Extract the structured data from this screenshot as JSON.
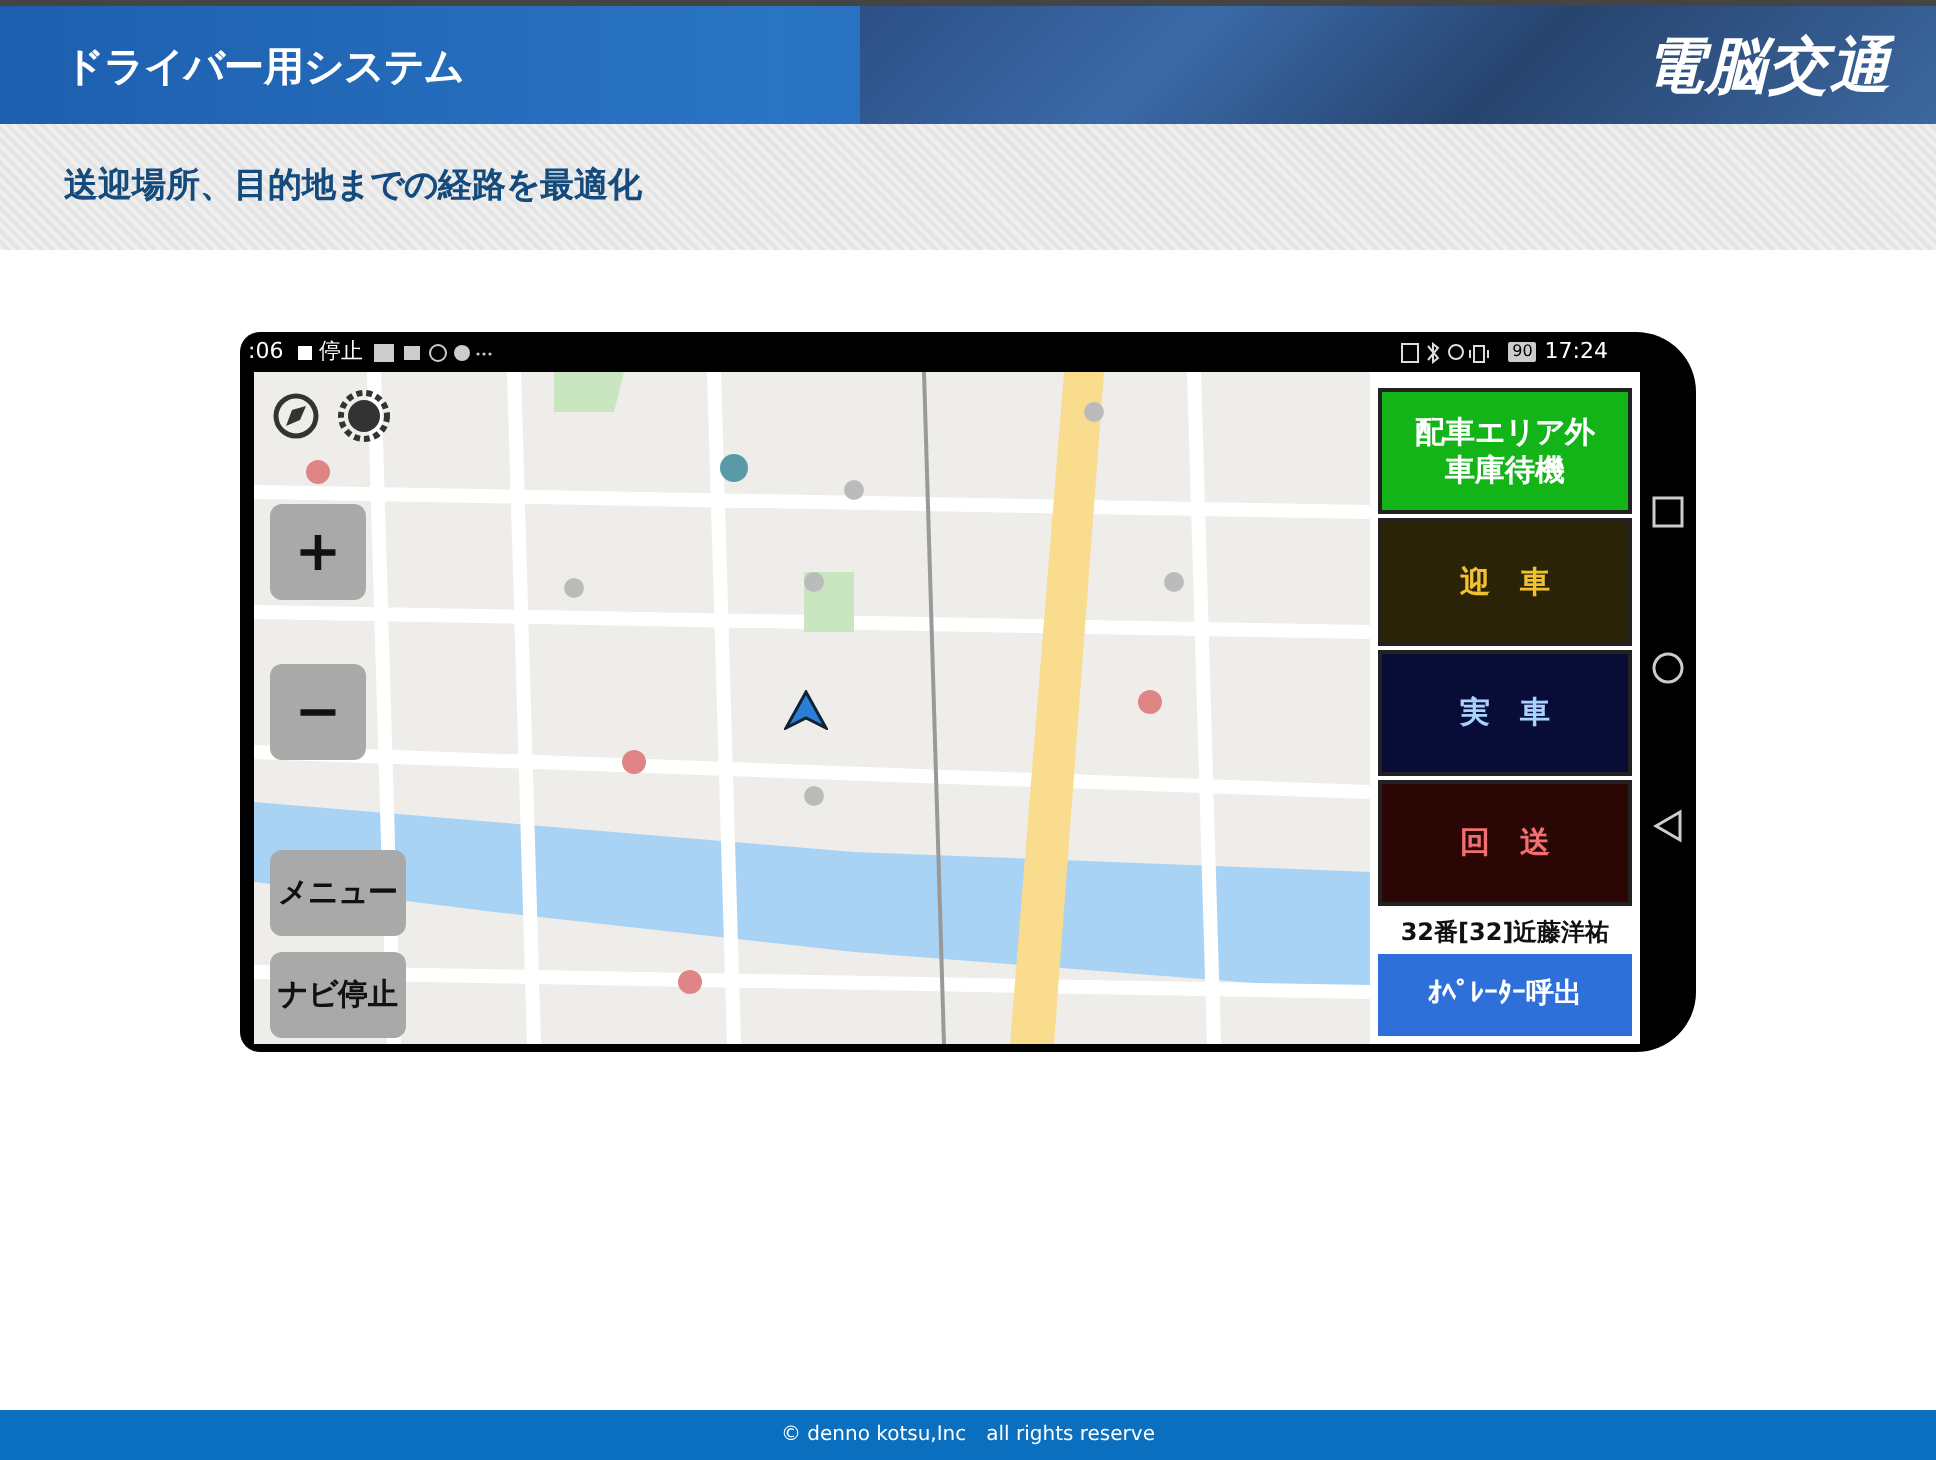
{
  "header": {
    "title": "ドライバー用システム",
    "logo": "電脳交通"
  },
  "subheader": {
    "title": "送迎場所、目的地までの経路を最適化"
  },
  "phone": {
    "status_bar": {
      "time_left": ":06",
      "status": "停止",
      "battery": "90",
      "time": "17:24"
    },
    "map_controls": [
      {
        "kind": "zoom",
        "label": "+"
      },
      {
        "kind": "zoom",
        "label": "−"
      },
      {
        "kind": "action",
        "label": "メニュー"
      },
      {
        "kind": "action",
        "label": "ナビ停止"
      }
    ],
    "status_buttons": [
      {
        "kind": "standby",
        "lines": [
          "配車エリア外",
          "車庫待機"
        ]
      },
      {
        "kind": "pickup",
        "lines": [
          "迎　車"
        ]
      },
      {
        "kind": "occupied",
        "lines": [
          "実　車"
        ]
      },
      {
        "kind": "deadhead",
        "lines": [
          "回　送"
        ]
      }
    ],
    "driver": "32番[32]近藤洋祐",
    "operator_button": "ｵﾍﾟﾚｰﾀｰ呼出"
  },
  "footer": "© denno kotsu,Inc　all rights reserve"
}
